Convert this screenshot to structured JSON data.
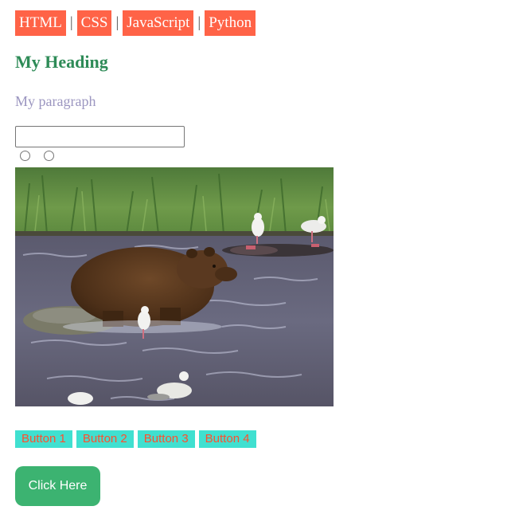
{
  "nav": {
    "links": [
      "HTML",
      "CSS",
      "JavaScript",
      "Python"
    ],
    "separator": "|"
  },
  "heading": "My Heading",
  "paragraph": "My paragraph",
  "form": {
    "text_value": "",
    "radio_count": 2
  },
  "image": {
    "subject": "brown bear standing in a river with seagulls"
  },
  "buttons": [
    "Button 1",
    "Button 2",
    "Button 3",
    "Button 4"
  ],
  "cta_label": "Click Here",
  "colors": {
    "nav_bg": "#ff6347",
    "heading": "#2e8b57",
    "paragraph": "#9b96c0",
    "button_bg": "#40e0d0",
    "button_text": "#ff4f2e",
    "cta_bg": "#3cb371"
  }
}
